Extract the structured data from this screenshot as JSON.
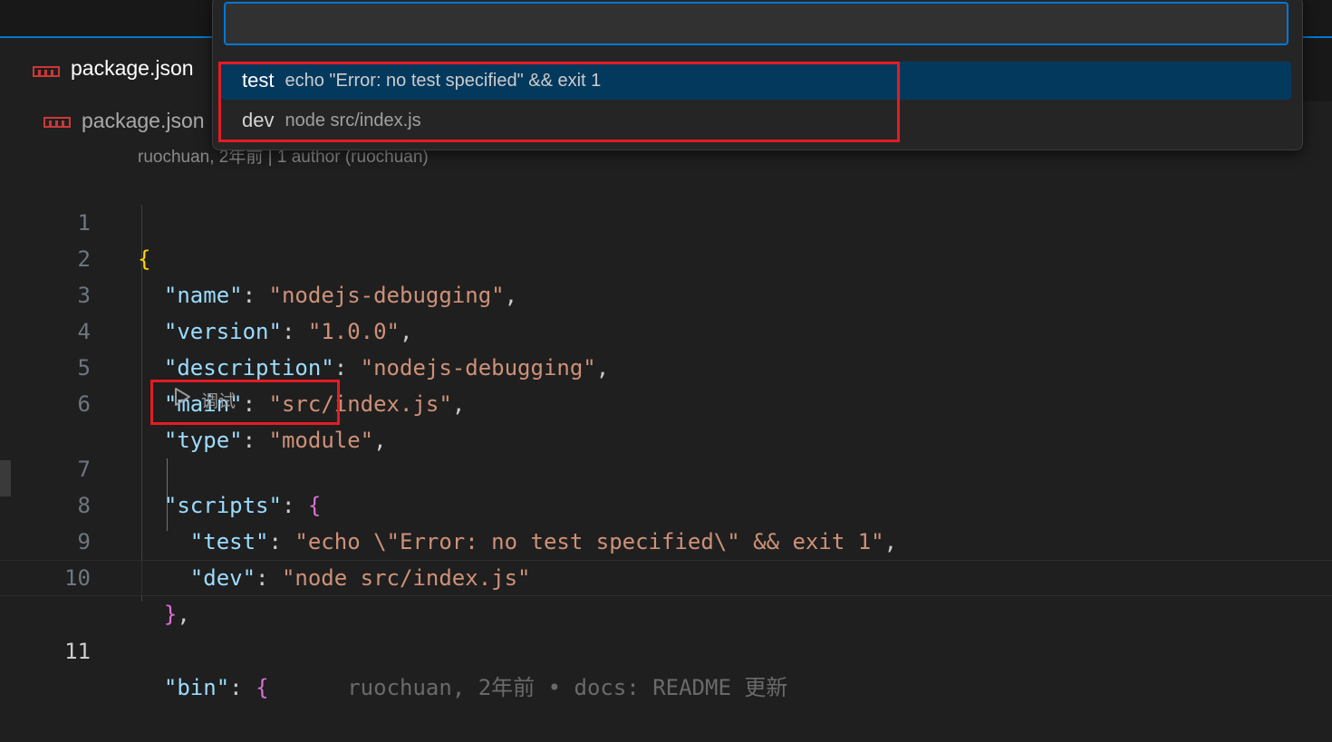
{
  "tab": {
    "label": "package.json"
  },
  "breadcrumb": {
    "label": "package.json"
  },
  "blame_header": "ruochuan, 2年前 | 1 author (ruochuan)",
  "codelens": {
    "label": "调试"
  },
  "quick_pick": {
    "input_value": "",
    "items": [
      {
        "name": "test",
        "description": "echo \"Error: no test specified\" && exit 1"
      },
      {
        "name": "dev",
        "description": "node src/index.js"
      }
    ]
  },
  "code_lines": [
    {
      "number": "1",
      "open_brace": "{"
    },
    {
      "number": "2",
      "key": "\"name\"",
      "colon": ": ",
      "value": "\"nodejs-debugging\"",
      "comma": ","
    },
    {
      "number": "3",
      "key": "\"version\"",
      "colon": ": ",
      "value": "\"1.0.0\"",
      "comma": ","
    },
    {
      "number": "4",
      "key": "\"description\"",
      "colon": ": ",
      "value": "\"nodejs-debugging\"",
      "comma": ","
    },
    {
      "number": "5",
      "key": "\"main\"",
      "colon": ": ",
      "value": "\"src/index.js\"",
      "comma": ","
    },
    {
      "number": "6",
      "key": "\"type\"",
      "colon": ": ",
      "value": "\"module\"",
      "comma": ","
    },
    {
      "number": "7",
      "key": "\"scripts\"",
      "colon": ": ",
      "brace": "{"
    },
    {
      "number": "8",
      "key": "\"test\"",
      "colon": ": ",
      "value": "\"echo \\\"Error: no test specified\\\" && exit 1\"",
      "comma": ","
    },
    {
      "number": "9",
      "key": "\"dev\"",
      "colon": ": ",
      "value": "\"node src/index.js\""
    },
    {
      "number": "10",
      "brace": "}",
      "comma": ","
    },
    {
      "number": "11",
      "key": "\"bin\"",
      "colon": ": ",
      "brace": "{",
      "blame": "ruochuan, 2年前 • docs: README 更新"
    }
  ],
  "colors": {
    "accent": "#0078d4",
    "highlight_box": "#e51b23",
    "json_key": "#9cdcfe",
    "json_string": "#ce9178",
    "bracket_level1": "#ffd700",
    "bracket_level2": "#da70d6"
  },
  "icons": {
    "file_icon": "json-file-icon",
    "codelens_icon": "play-icon"
  }
}
